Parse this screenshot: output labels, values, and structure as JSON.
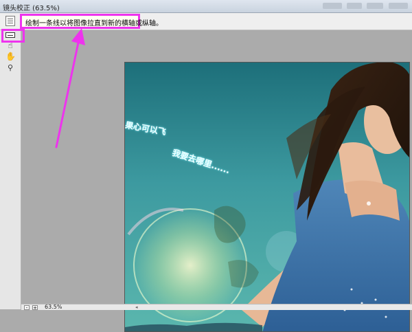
{
  "window": {
    "title": "镜头校正 (63.5%)"
  },
  "options": {
    "hint": "绘制一条线以将图像拉直到新的横轴或纵轴。"
  },
  "tools": [
    {
      "name": "straighten-tool",
      "icon": "straighten-icon"
    },
    {
      "name": "move-grid-tool",
      "icon": "hand-pointer-icon"
    },
    {
      "name": "hand-tool",
      "icon": "hand-icon"
    },
    {
      "name": "zoom-tool",
      "icon": "magnifier-icon"
    }
  ],
  "photo": {
    "caption_line1": "果心可以飞",
    "caption_line2": "我要去哪里......"
  },
  "status": {
    "zoom_out": "-",
    "zoom_in": "+",
    "zoom": "63.5%"
  },
  "colors": {
    "annotation": "#ee33ee"
  }
}
